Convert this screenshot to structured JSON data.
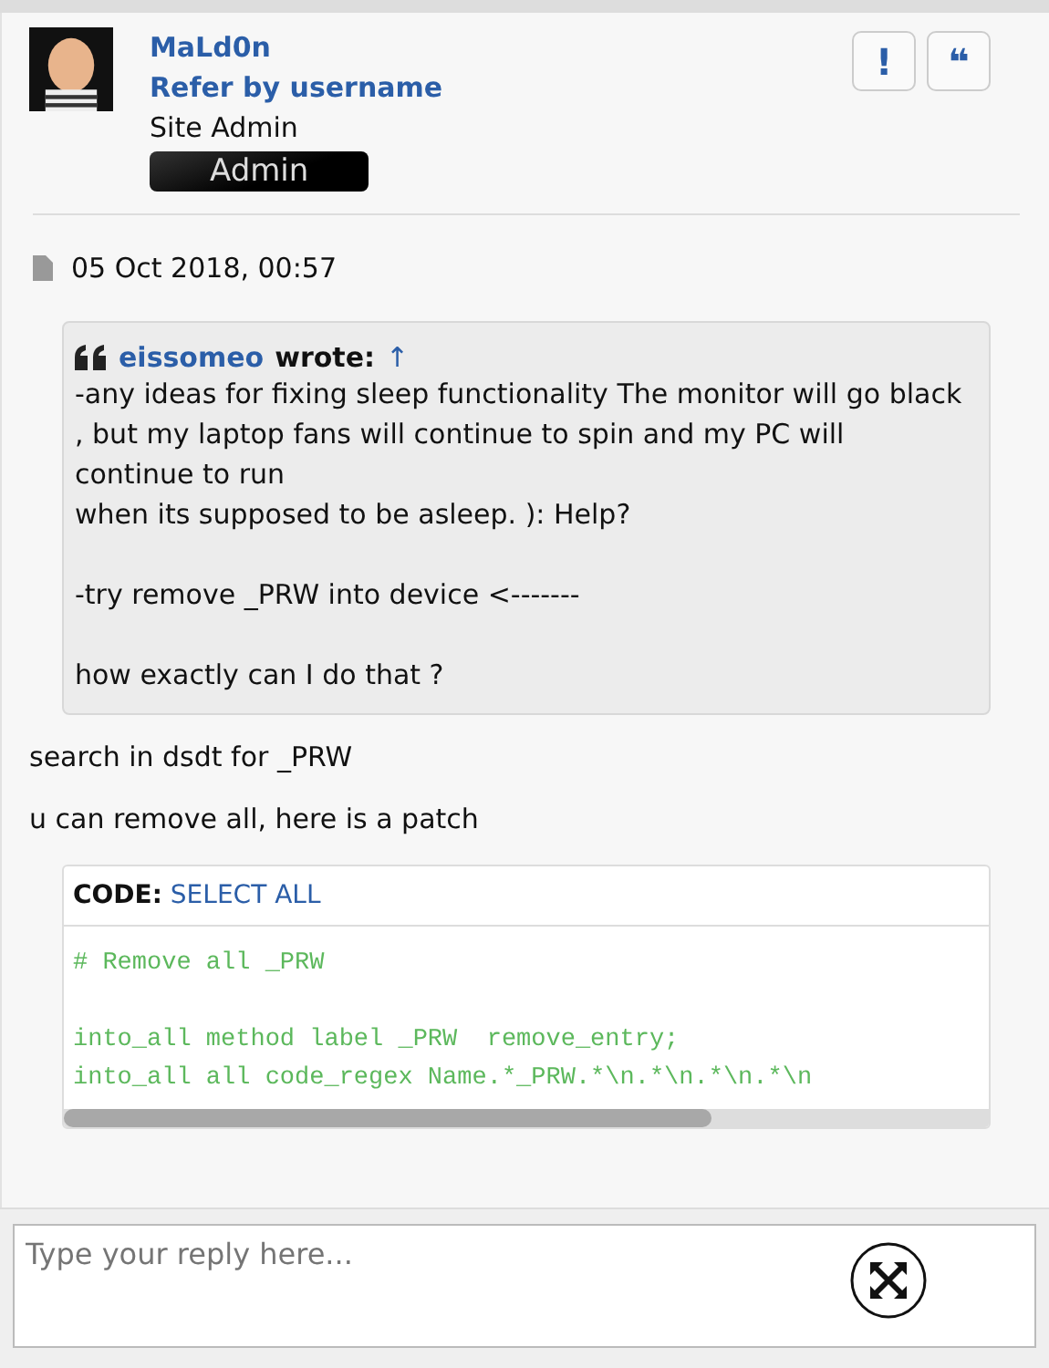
{
  "post": {
    "author": "MaLd0n",
    "subtitle": "Refer by username",
    "role": "Site Admin",
    "rank_badge": "Admin",
    "actions": [
      {
        "label": "!"
      },
      {
        "label": "❝"
      }
    ],
    "date": "05 Oct 2018, 00:57"
  },
  "quote": {
    "author": "eissomeo",
    "wrote": "wrote:",
    "jump": "↑",
    "paragraphs": [
      [
        "-any ideas for fixing sleep functionality The monitor will go black , but my laptop fans will continue to spin and my PC will continue to run",
        "when its supposed to be asleep. ): Help?"
      ],
      [
        "-try remove _PRW into device <-------"
      ],
      [
        "how exactly can I do that ?"
      ]
    ]
  },
  "body": [
    "search in dsdt for _PRW",
    "u can remove all, here is a patch"
  ],
  "code": {
    "label": "CODE:",
    "select_all": "SELECT ALL",
    "blocks": [
      [
        "# Remove all _PRW"
      ],
      [
        "into_all method label _PRW  remove_entry;",
        "into_all all code_regex Name.*_PRW.*\\n.*\\n.*\\n.*\\n"
      ]
    ]
  },
  "reply": {
    "placeholder": "Type your reply here..."
  }
}
